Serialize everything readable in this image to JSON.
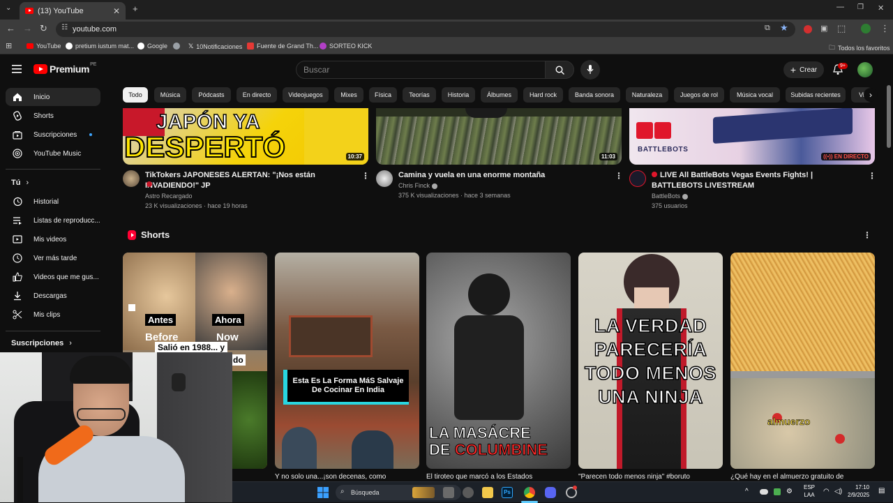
{
  "browser": {
    "tab_title": "(13) YouTube",
    "url": "youtube.com",
    "bookmarks": [
      "YouTube",
      "pretium iustum mat...",
      "Google",
      "10Notificaciones",
      "Fuente de Grand Th...",
      "SORTEO KICK"
    ],
    "all_bookmarks": "Todos los favoritos"
  },
  "header": {
    "logo_text": "Premium",
    "logo_region": "PE",
    "search_placeholder": "Buscar",
    "create_label": "Crear",
    "notif_badge": "9+"
  },
  "sidebar": {
    "main": [
      {
        "label": "Inicio",
        "icon": "home-icon"
      },
      {
        "label": "Shorts",
        "icon": "shorts-icon"
      },
      {
        "label": "Suscripciones",
        "icon": "subscriptions-icon"
      },
      {
        "label": "YouTube Music",
        "icon": "music-icon"
      }
    ],
    "you_header": "Tú",
    "you": [
      {
        "label": "Historial",
        "icon": "history-icon"
      },
      {
        "label": "Listas de reproducc...",
        "icon": "playlists-icon"
      },
      {
        "label": "Mis videos",
        "icon": "my-videos-icon"
      },
      {
        "label": "Ver más tarde",
        "icon": "watch-later-icon"
      },
      {
        "label": "Videos que me gus...",
        "icon": "liked-icon"
      },
      {
        "label": "Descargas",
        "icon": "download-icon"
      },
      {
        "label": "Mis clips",
        "icon": "clips-icon"
      }
    ],
    "subs_header": "Suscripciones"
  },
  "chips": [
    "Todo",
    "Música",
    "Pódcasts",
    "En directo",
    "Videojuegos",
    "Mixes",
    "Física",
    "Teorías",
    "Historia",
    "Álbumes",
    "Hard rock",
    "Banda sonora",
    "Naturaleza",
    "Juegos de rol",
    "Música vocal",
    "Subidas recientes",
    "Vi"
  ],
  "videos": [
    {
      "title": "TikTokers JAPONESES ALERTAN: \"¡Nos están INVADIENDO!\" JP",
      "channel": "Astro Recargado",
      "meta": "23 K visualizaciones · hace 19 horas",
      "duration": "10:37",
      "thumb_text_1": "JAPÓN YA",
      "thumb_text_2": "DESPERTÓ"
    },
    {
      "title": "Camina y vuela en una enorme montaña",
      "channel": "Chris Finck",
      "meta": "375 K visualizaciones · hace 3 semanas",
      "duration": "11:03"
    },
    {
      "title": "LIVE All BattleBots Vegas Events Fights! | BATTLEBOTS LIVESTREAM",
      "channel": "BattleBots",
      "meta": "375 usuarios",
      "live_badge": "EN DIRECTO",
      "thumb_text_1": "BATTLEBOTS"
    }
  ],
  "shorts_title": "Shorts",
  "shorts": [
    {
      "title": "Salió en 1988... y",
      "overlay_1": "Antes",
      "overlay_2": "Ahora",
      "overlay_3": "Before",
      "overlay_4": "Now",
      "overlay_5": "Salió en 1988... y",
      "overlay_6": "do"
    },
    {
      "title": "Y no solo una...¡son decenas, como",
      "overlay_1": "Esta Es La Forma MáS Salvaje De Cocinar En India"
    },
    {
      "title": "El tiroteo que marcó a los Estados",
      "overlay_1": "LA MASÁCRE",
      "overlay_2": "DE",
      "overlay_3": "COLUMBINE"
    },
    {
      "title": "\"Parecen todo menos ninja\" #boruto",
      "overlay_1": "LA VERDAD PARECERÍA TODO MENOS UNA NINJA"
    },
    {
      "title": "¿Qué hay en el almuerzo gratuito de",
      "overlay_1": "almuerzo"
    }
  ],
  "taskbar": {
    "search": "Búsqueda",
    "lang_1": "ESP",
    "lang_2": "LAA",
    "time": "17:10",
    "date": "2/9/2025"
  },
  "colors": {
    "accent": "#ff0000",
    "bg": "#0f0f0f",
    "chip": "#272727"
  }
}
